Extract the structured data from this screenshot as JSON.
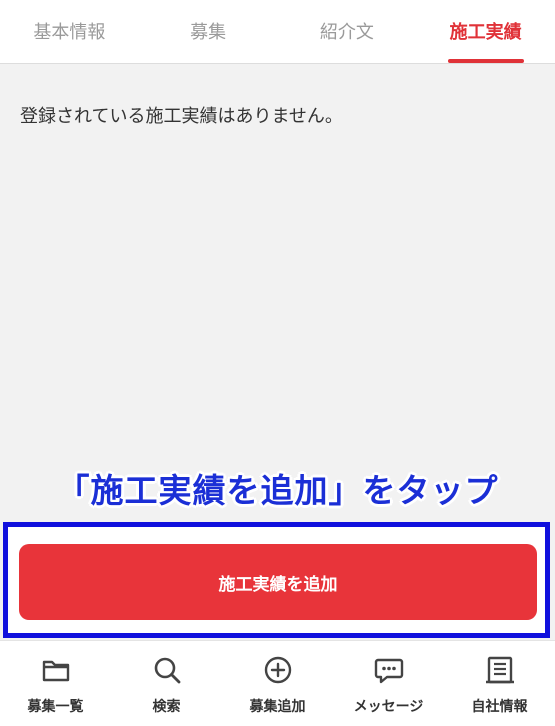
{
  "tabs": [
    {
      "label": "基本情報",
      "active": false
    },
    {
      "label": "募集",
      "active": false
    },
    {
      "label": "紹介文",
      "active": false
    },
    {
      "label": "施工実績",
      "active": true
    }
  ],
  "content": {
    "empty_message": "登録されている施工実績はありません。"
  },
  "annotation": {
    "text": "「施工実績を追加」をタップ"
  },
  "action": {
    "add_label": "施工実績を追加"
  },
  "bottom_nav": [
    {
      "label": "募集一覧",
      "icon": "folder-icon"
    },
    {
      "label": "検索",
      "icon": "search-icon"
    },
    {
      "label": "募集追加",
      "icon": "plus-circle-icon"
    },
    {
      "label": "メッセージ",
      "icon": "message-icon"
    },
    {
      "label": "自社情報",
      "icon": "document-icon"
    }
  ],
  "colors": {
    "accent": "#e03238",
    "button": "#e8343a",
    "annotation": "#1b2fd6",
    "highlight_border": "#1010dd"
  }
}
